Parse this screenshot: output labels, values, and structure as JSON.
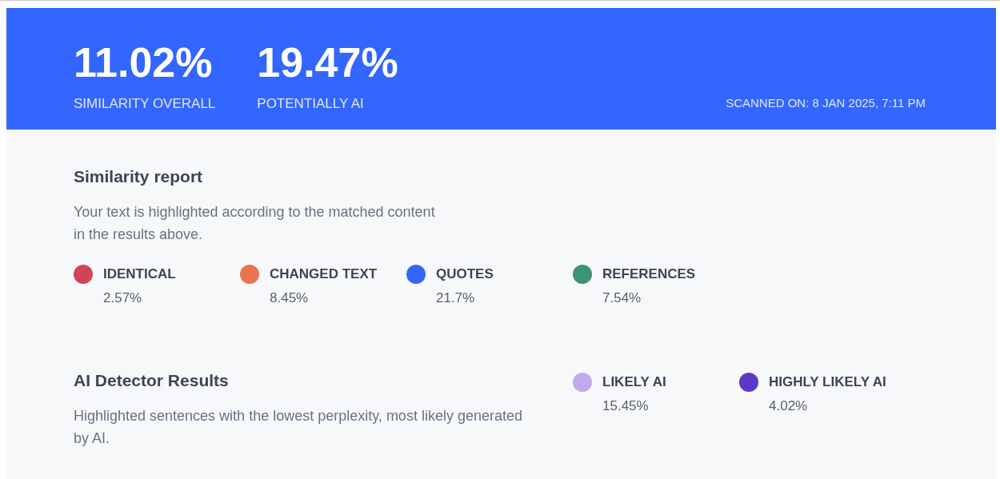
{
  "header": {
    "stats": [
      {
        "value": "11.02%",
        "label": "SIMILARITY OVERALL"
      },
      {
        "value": "19.47%",
        "label": "POTENTIALLY AI"
      }
    ],
    "scanned_on": "SCANNED ON: 8 JAN 2025, 7:11 PM"
  },
  "similarity_report": {
    "title": "Similarity report",
    "description": "Your text is highlighted according to the matched content in the results above.",
    "categories": [
      {
        "label": "IDENTICAL",
        "value": "2.57%",
        "color": "#d2435a"
      },
      {
        "label": "CHANGED TEXT",
        "value": "8.45%",
        "color": "#ea7350"
      },
      {
        "label": "QUOTES",
        "value": "21.7%",
        "color": "#3366ff"
      },
      {
        "label": "REFERENCES",
        "value": "7.54%",
        "color": "#3d9474"
      }
    ]
  },
  "ai_detector": {
    "title": "AI Detector Results",
    "description": "Highlighted sentences with the lowest perplexity, most likely generated by AI.",
    "categories": [
      {
        "label": "LIKELY AI",
        "value": "15.45%",
        "color": "#c2a9ec"
      },
      {
        "label": "HIGHLY LIKELY AI",
        "value": "4.02%",
        "color": "#5b39c4"
      }
    ]
  }
}
